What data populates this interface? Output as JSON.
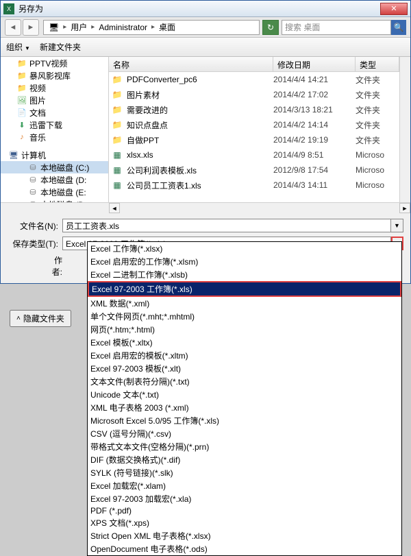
{
  "title": "另存为",
  "breadcrumb": {
    "icon": "🖥",
    "p1": "用户",
    "p2": "Administrator",
    "p3": "桌面"
  },
  "search": {
    "placeholder": "搜索 桌面"
  },
  "toolbar": {
    "organize": "组织",
    "new_folder": "新建文件夹"
  },
  "sidebar": {
    "items": [
      {
        "label": "PPTV视频",
        "icon": "📁",
        "cls": "ico-folder"
      },
      {
        "label": "暴风影视库",
        "icon": "📁",
        "cls": "ico-folder"
      },
      {
        "label": "视频",
        "icon": "📁",
        "cls": "ico-folder"
      },
      {
        "label": "图片",
        "icon": "🖼",
        "cls": "ico-img"
      },
      {
        "label": "文档",
        "icon": "📄",
        "cls": "ico-doc"
      },
      {
        "label": "迅雷下载",
        "icon": "⬇",
        "cls": "ico-down"
      },
      {
        "label": "音乐",
        "icon": "♪",
        "cls": "ico-music"
      }
    ],
    "computer": {
      "label": "计算机",
      "icon": "🖥",
      "cls": "ico-pc"
    },
    "drives": [
      {
        "label": "本地磁盘 (C:)",
        "icon": "⛁"
      },
      {
        "label": "本地磁盘 (D:",
        "icon": "⛁"
      },
      {
        "label": "本地磁盘 (E:",
        "icon": "⛁"
      },
      {
        "label": "本地磁盘 (D:",
        "icon": "⛁"
      }
    ]
  },
  "columns": {
    "name": "名称",
    "date": "修改日期",
    "type": "类型"
  },
  "files": [
    {
      "icon": "📁",
      "cls": "ico-fold",
      "name": "PDFConverter_pc6",
      "date": "2014/4/4 14:21",
      "type": "文件夹"
    },
    {
      "icon": "📁",
      "cls": "ico-fold",
      "name": "图片素材",
      "date": "2014/4/2 17:02",
      "type": "文件夹"
    },
    {
      "icon": "📁",
      "cls": "ico-fold",
      "name": "需要改进的",
      "date": "2014/3/13 18:21",
      "type": "文件夹"
    },
    {
      "icon": "📁",
      "cls": "ico-fold",
      "name": "知识点盘点",
      "date": "2014/4/2 14:14",
      "type": "文件夹"
    },
    {
      "icon": "📁",
      "cls": "ico-fold",
      "name": "自做PPT",
      "date": "2014/4/2 19:19",
      "type": "文件夹"
    },
    {
      "icon": "▦",
      "cls": "ico-xls",
      "name": "xlsx.xls",
      "date": "2014/4/9 8:51",
      "type": "Microso"
    },
    {
      "icon": "▦",
      "cls": "ico-xls",
      "name": "公司利润表模板.xls",
      "date": "2012/9/8 17:54",
      "type": "Microso"
    },
    {
      "icon": "▦",
      "cls": "ico-xls",
      "name": "公司员工工资表1.xls",
      "date": "2014/4/3 14:11",
      "type": "Microso"
    }
  ],
  "form": {
    "filename_label": "文件名(N):",
    "filename_value": "员工工资表.xls",
    "savetype_label": "保存类型(T):",
    "savetype_value": "Excel 97-2003 工作簿(*.xls)",
    "author_label": "作者:"
  },
  "hide_folders": "隐藏文件夹",
  "save_types": [
    "Excel 工作簿(*.xlsx)",
    "Excel 启用宏的工作簿(*.xlsm)",
    "Excel 二进制工作簿(*.xlsb)",
    "Excel 97-2003 工作簿(*.xls)",
    "XML 数据(*.xml)",
    "单个文件网页(*.mht;*.mhtml)",
    "网页(*.htm;*.html)",
    "Excel 模板(*.xltx)",
    "Excel 启用宏的模板(*.xltm)",
    "Excel 97-2003 模板(*.xlt)",
    "文本文件(制表符分隔)(*.txt)",
    "Unicode 文本(*.txt)",
    "XML 电子表格 2003 (*.xml)",
    "Microsoft Excel 5.0/95 工作簿(*.xls)",
    "CSV (逗号分隔)(*.csv)",
    "带格式文本文件(空格分隔)(*.prn)",
    "DIF (数据交换格式)(*.dif)",
    "SYLK (符号链接)(*.slk)",
    "Excel 加载宏(*.xlam)",
    "Excel 97-2003 加载宏(*.xla)",
    "PDF (*.pdf)",
    "XPS 文档(*.xps)",
    "Strict Open XML 电子表格(*.xlsx)",
    "OpenDocument 电子表格(*.ods)"
  ],
  "selected_type_index": 3
}
